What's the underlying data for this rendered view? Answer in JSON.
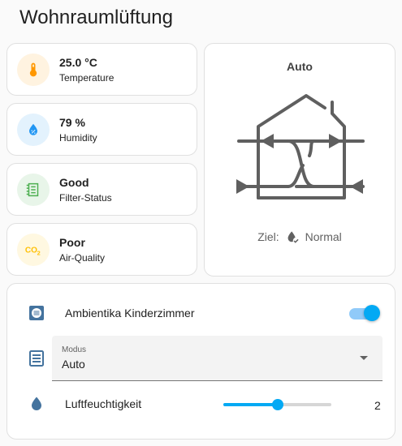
{
  "page": {
    "title": "Wohnraumlüftung"
  },
  "tiles": [
    {
      "value": "25.0 °C",
      "label": "Temperature",
      "icon": "thermometer-icon",
      "color": "#ff9800",
      "bg": "#fff3e0"
    },
    {
      "value": "79 %",
      "label": "Humidity",
      "icon": "water-percent-icon",
      "color": "#2196f3",
      "bg": "#e3f2fd"
    },
    {
      "value": "Good",
      "label": "Filter-Status",
      "icon": "air-filter-icon",
      "color": "#4caf50",
      "bg": "#e8f5e9"
    },
    {
      "value": "Poor",
      "label": "Air-Quality",
      "icon": "molecule-co2-icon",
      "color": "#ffc107",
      "bg": "#fff8e1"
    }
  ],
  "fan_card": {
    "mode": "Auto",
    "target_label": "Ziel:",
    "target_value": "Normal",
    "icon": "heat-recovery-ventilation-icon"
  },
  "entities": {
    "switch": {
      "label": "Ambientika Kinderzimmer",
      "on": true,
      "icon": "fan-icon"
    },
    "select": {
      "label": "Modus",
      "value": "Auto",
      "icon": "form-dropdown-icon"
    },
    "slider": {
      "label": "Luftfeuchtigkeit",
      "value": "2",
      "level": 0.5,
      "icon": "water-icon"
    }
  },
  "colors": {
    "accent": "#03a9f4",
    "icon_blue": "#44739e"
  }
}
